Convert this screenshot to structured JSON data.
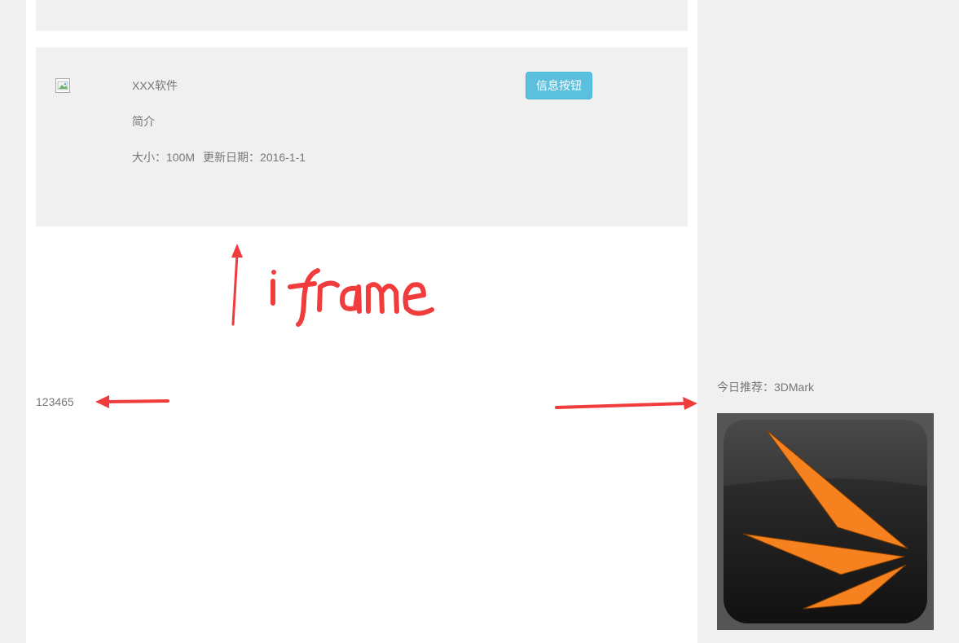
{
  "software_card": {
    "name": "XXX软件",
    "intro": "简介",
    "size": "大小：100M",
    "updated": "更新日期：2016-1-1",
    "button_label": "信息按钮"
  },
  "annotation": {
    "handwritten_label": "iframe"
  },
  "footer": {
    "number_text": "123465"
  },
  "sidebar": {
    "recommend_text": "今日推荐：3DMark"
  },
  "colors": {
    "page_background": "#f0f0f0",
    "info_button": "#5bc0de",
    "annotation_red": "#f03c3c",
    "logo_orange": "#f5821f"
  }
}
